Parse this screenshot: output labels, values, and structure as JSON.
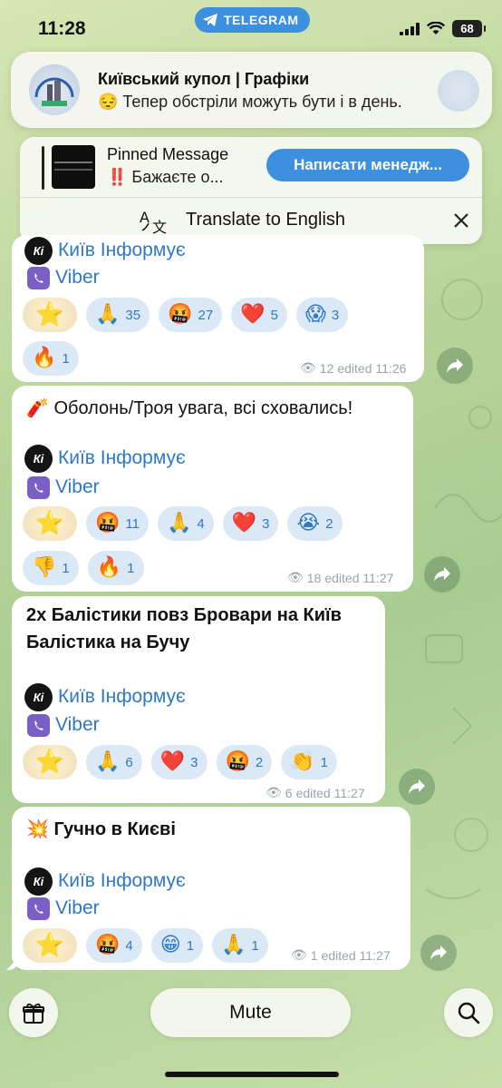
{
  "status_bar": {
    "time": "11:28",
    "app_pill": "TELEGRAM",
    "battery": "68"
  },
  "notification": {
    "title": "Київський купол | Графіки",
    "body": "😔 Тепер обстріли можуть бути і в день.",
    "avatar_icon": "kyiv-dome-avatar"
  },
  "pinned": {
    "title": "Pinned Message",
    "text": "‼️ Бажаєте о...",
    "button": "Написати менедж...",
    "translate": "Translate to English"
  },
  "source": {
    "name": "Київ Інформує",
    "viber": "Viber",
    "logo": "Кi"
  },
  "messages": [
    {
      "text": "",
      "reactions": [
        {
          "emoji": "⭐",
          "count": ""
        },
        {
          "emoji": "🙏",
          "count": "35"
        },
        {
          "emoji": "🤬",
          "count": "27"
        },
        {
          "emoji": "❤️",
          "count": "5"
        },
        {
          "emoji": "😱",
          "count": "3"
        },
        {
          "emoji": "🔥",
          "count": "1"
        }
      ],
      "views": "12",
      "meta": "edited 11:26"
    },
    {
      "text": "🧨 Оболонь/Троя увага, всі сховались!",
      "reactions": [
        {
          "emoji": "⭐",
          "count": ""
        },
        {
          "emoji": "🤬",
          "count": "11"
        },
        {
          "emoji": "🙏",
          "count": "4"
        },
        {
          "emoji": "❤️",
          "count": "3"
        },
        {
          "emoji": "😭",
          "count": "2"
        },
        {
          "emoji": "👎",
          "count": "1"
        },
        {
          "emoji": "🔥",
          "count": "1"
        }
      ],
      "views": "18",
      "meta": "edited 11:27"
    },
    {
      "text_lines": [
        "2х Балістики повз Бровари на Київ",
        "Балістика на Бучу"
      ],
      "reactions": [
        {
          "emoji": "⭐",
          "count": ""
        },
        {
          "emoji": "🙏",
          "count": "6"
        },
        {
          "emoji": "❤️",
          "count": "3"
        },
        {
          "emoji": "🤬",
          "count": "2"
        },
        {
          "emoji": "👏",
          "count": "1"
        }
      ],
      "views": "6",
      "meta": "edited 11:27"
    },
    {
      "text": "💥 Гучно в Києві",
      "reactions": [
        {
          "emoji": "⭐",
          "count": ""
        },
        {
          "emoji": "🤬",
          "count": "4"
        },
        {
          "emoji": "😁",
          "count": "1"
        },
        {
          "emoji": "🙏",
          "count": "1"
        }
      ],
      "views": "1",
      "meta": "edited 11:27"
    }
  ],
  "bottom": {
    "mute": "Mute",
    "gift_icon": "gift-icon",
    "search_icon": "search-icon"
  },
  "colors": {
    "accent": "#3d8fe0",
    "link": "#2f78c4",
    "reaction_bg": "#dbe9f7"
  }
}
